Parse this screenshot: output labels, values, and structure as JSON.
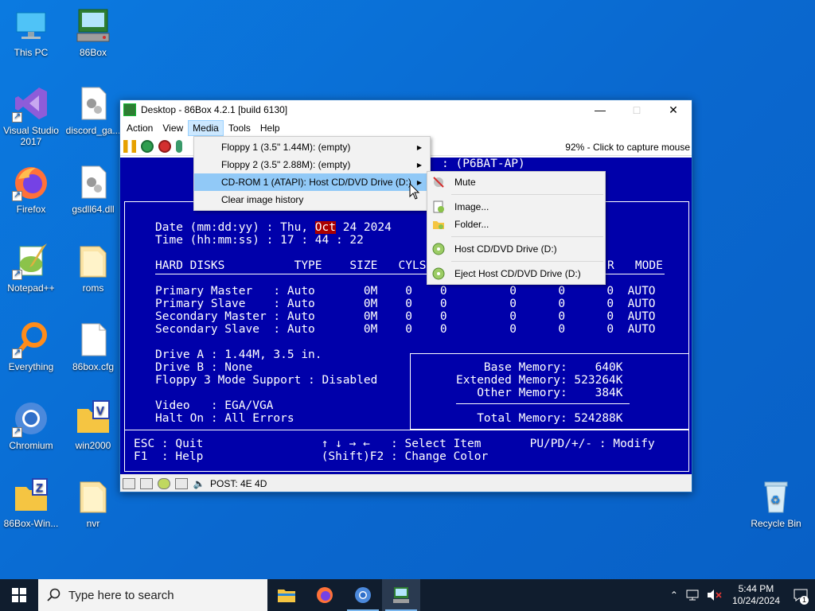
{
  "desktop": {
    "icons": [
      {
        "label": "This PC",
        "icon": "computer-icon"
      },
      {
        "label": "86Box",
        "icon": "86box-icon"
      },
      {
        "label": "Visual Studio 2017",
        "icon": "visual-studio-icon"
      },
      {
        "label": "discord_ga...",
        "icon": "dll-file-icon"
      },
      {
        "label": "Firefox",
        "icon": "firefox-icon"
      },
      {
        "label": "gsdll64.dll",
        "icon": "dll-file-icon"
      },
      {
        "label": "Notepad++",
        "icon": "notepadpp-icon"
      },
      {
        "label": "roms",
        "icon": "folder-icon"
      },
      {
        "label": "Everything",
        "icon": "everything-search-icon"
      },
      {
        "label": "86box.cfg",
        "icon": "file-icon"
      },
      {
        "label": "Chromium",
        "icon": "chromium-icon"
      },
      {
        "label": "win2000",
        "icon": "folder-icon"
      },
      {
        "label": "86Box-Win...",
        "icon": "zip-folder-icon"
      },
      {
        "label": "nvr",
        "icon": "folder-icon"
      },
      {
        "label": "Recycle Bin",
        "icon": "recycle-bin-icon"
      }
    ]
  },
  "window": {
    "title": "Desktop - 86Box 4.2.1 [build 6130]",
    "menus": [
      "Action",
      "View",
      "Media",
      "Tools",
      "Help"
    ],
    "capture_hint": "92% - Click to capture mouse"
  },
  "media_menu": {
    "items": [
      {
        "label": "Floppy 1 (3.5\" 1.44M): (empty)",
        "submenu": true
      },
      {
        "label": "Floppy 2 (3.5\" 2.88M): (empty)",
        "submenu": true
      },
      {
        "label": "CD-ROM 1 (ATAPI): Host CD/DVD Drive (D:)",
        "submenu": true
      },
      {
        "label": "Clear image history",
        "submenu": false
      }
    ]
  },
  "cdrom_submenu": {
    "items": [
      "Mute",
      "Image...",
      "Folder...",
      "Host CD/DVD Drive (D:)",
      "Eject Host CD/DVD Drive (D:)"
    ]
  },
  "bios": {
    "header_fragment": ": (P6BAT-AP)",
    "date_label": "Date (mm:dd:yy) : Thu, ",
    "date_month": "Oct",
    "date_rest": " 24 2024",
    "time_line": "Time (hh:mm:ss) : 17 : 44 : 22",
    "disk_header": "HARD DISKS          TYPE    SIZE   CYLS",
    "disk_header_tail": "R   MODE",
    "disks": [
      "Primary Master   : Auto       0M    0    0         0      0      0  AUTO",
      "Primary Slave    : Auto       0M    0    0         0      0      0  AUTO",
      "Secondary Master : Auto       0M    0    0         0      0      0  AUTO",
      "Secondary Slave  : Auto       0M    0    0         0      0      0  AUTO"
    ],
    "drives": [
      "Drive A : 1.44M, 3.5 in.",
      "Drive B : None",
      "Floppy 3 Mode Support : Disabled"
    ],
    "video_line": "Video   : EGA/VGA",
    "halt_line": "Halt On : All Errors",
    "memory": [
      "    Base Memory:    640K",
      "Extended Memory: 523264K",
      "   Other Memory:    384K"
    ],
    "total_memory": "   Total Memory: 524288K",
    "footer1": "ESC : Quit                 ↑ ↓ → ←   : Select Item       PU/PD/+/- : Modify",
    "footer2": "F1  : Help                 (Shift)F2 : Change Color"
  },
  "status": {
    "post_code": "POST: 4E 4D"
  },
  "taskbar": {
    "search_placeholder": "Type here to search",
    "time": "5:44 PM",
    "date": "10/24/2024",
    "notification_count": "1"
  },
  "colors": {
    "bios_bg": "#0000aa",
    "highlight": "#aa0000",
    "desktop": "#0a6fd6",
    "menu_selected": "#91c9f7"
  }
}
